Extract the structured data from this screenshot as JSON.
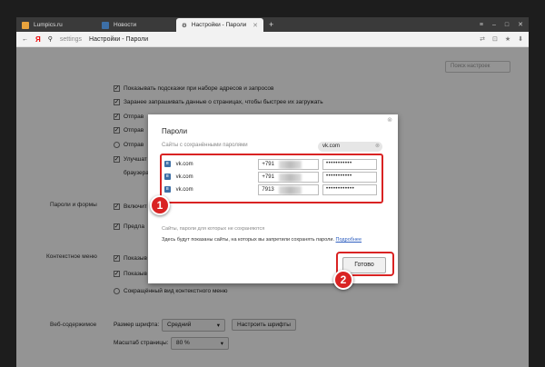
{
  "tabs": [
    {
      "label": "Lumpics.ru",
      "active": false
    },
    {
      "label": "Новости",
      "active": false
    },
    {
      "label": "Настройки - Пароли",
      "active": true
    }
  ],
  "addressbar": {
    "ya": "Я",
    "host": "settings",
    "page_title": "Настройки - Пароли"
  },
  "settings": {
    "search_placeholder": "Поиск настроек",
    "options": [
      {
        "label": "Показывать подсказки при наборе адресов и запросов",
        "checked": true
      },
      {
        "label": "Заранее запрашивать данные о страницах, чтобы быстрее их загружать",
        "checked": true
      },
      {
        "label": "Отправ",
        "checked": true
      },
      {
        "label": "Отправ",
        "checked": true
      },
      {
        "label": "Отправ",
        "checked": false
      },
      {
        "label": "Улучшат",
        "checked": true
      },
      {
        "label": "браузера",
        "checked": false
      }
    ],
    "section_passwords": "Пароли и формы",
    "passwords_options": [
      {
        "label": "Включит",
        "checked": true
      },
      {
        "label": "Предла",
        "checked": true
      }
    ],
    "section_context": "Контекстное меню",
    "context_options": [
      {
        "label": "Показыв",
        "checked": true
      },
      {
        "label": "Показыв",
        "checked": true
      },
      {
        "label": "Сокращённый вид контекстного меню",
        "checked": false
      }
    ],
    "section_web": "Веб-содержимое",
    "font_size_label": "Размер шрифта:",
    "font_size_value": "Средний",
    "customize_fonts_button": "Настроить шрифты",
    "zoom_label": "Масштаб страницы:",
    "zoom_value": "80 %"
  },
  "modal": {
    "title": "Пароли",
    "saved_label": "Сайты с сохранёнными паролями",
    "search_value": "vk.com",
    "entries": [
      {
        "site": "vk.com",
        "login": "+791",
        "password": "•••••••••••"
      },
      {
        "site": "vk.com",
        "login": "+791",
        "password": "•••••••••••"
      },
      {
        "site": "vk.com",
        "login": "7913",
        "password": "••••••••••••"
      }
    ],
    "never_label": "Сайты, пароли для которых не сохраняются",
    "never_text": "Здесь будут показаны сайты, на которых вы запретили сохранять пароли.",
    "learn_more": "Подробнее",
    "done_button": "Готово"
  },
  "markers": [
    "1",
    "2"
  ],
  "colors": {
    "highlight": "#d92323",
    "vk": "#3d6fa6"
  }
}
